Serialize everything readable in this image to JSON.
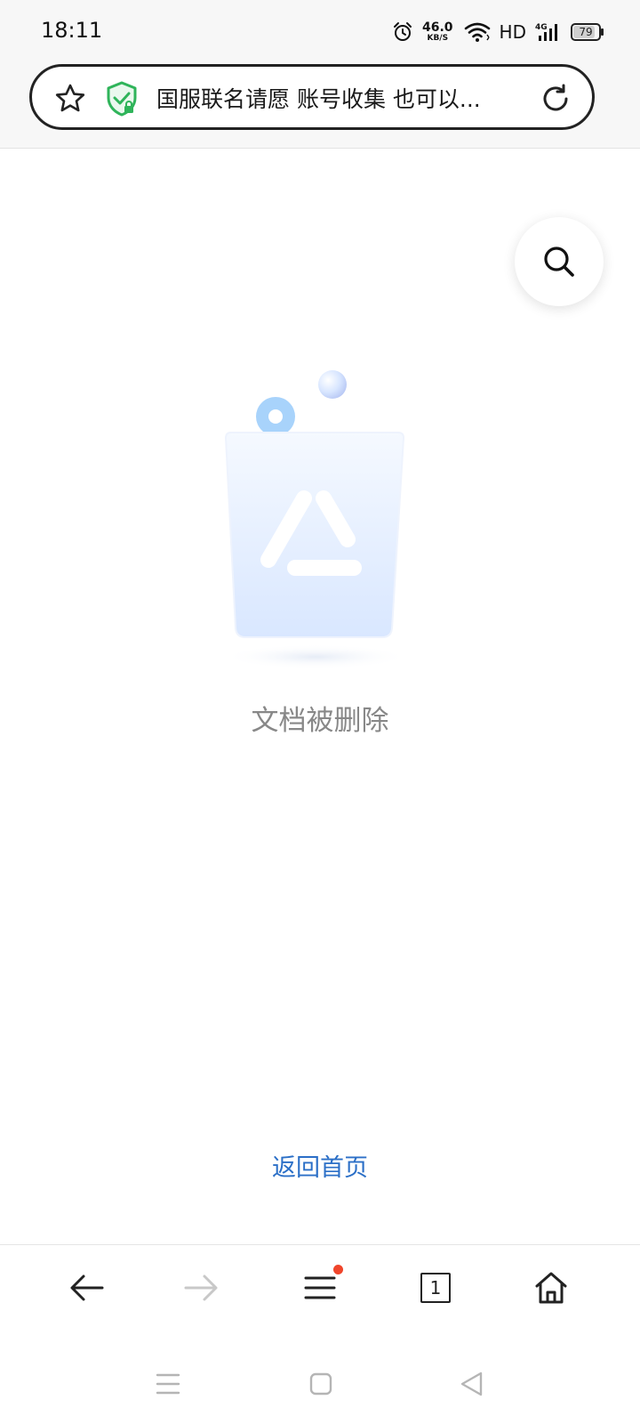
{
  "status_bar": {
    "time": "18:11",
    "net_speed_value": "46.0",
    "net_speed_unit": "KB/S",
    "hd_label": "HD",
    "network_label": "4G",
    "battery_level": "79",
    "icons": [
      "alarm-icon",
      "wifi-icon",
      "signal-icon",
      "battery-icon"
    ]
  },
  "address_bar": {
    "title": "国服联名请愿 账号收集 也可以...",
    "icons": [
      "star-icon",
      "shield-check-icon",
      "reload-icon"
    ],
    "shield_color": "#2fb45a"
  },
  "main": {
    "empty_message": "文档被删除",
    "home_link": "返回首页",
    "link_color": "#2b6fc7",
    "icons": [
      "search-icon",
      "recycle-bin-illustration"
    ]
  },
  "bottom_toolbar": {
    "tab_count": "1",
    "notification_dot_color": "#f0452b",
    "icons": [
      "back-arrow-icon",
      "forward-arrow-icon",
      "menu-icon",
      "tabs-icon",
      "home-icon"
    ]
  },
  "system_nav": {
    "icons": [
      "recents-icon",
      "home-square-icon",
      "back-triangle-icon"
    ]
  }
}
